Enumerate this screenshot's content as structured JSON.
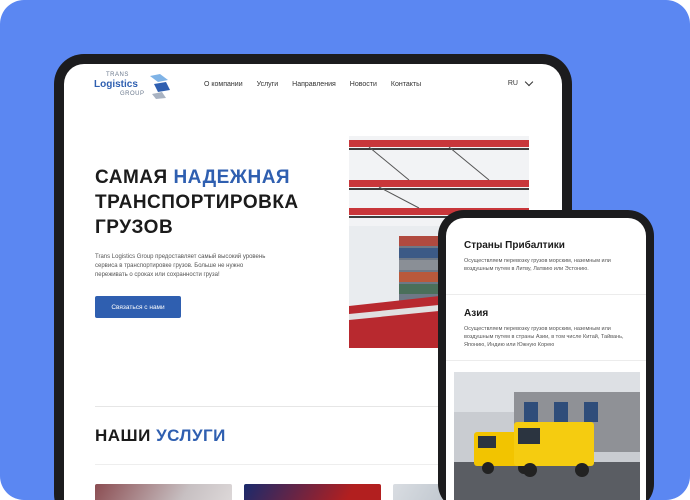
{
  "logo": {
    "line1": "TRANS",
    "line2": "LOGISTICS",
    "line3": "GROUP"
  },
  "nav": {
    "items": [
      "О компании",
      "Услуги",
      "Направления",
      "Новости",
      "Контакты"
    ]
  },
  "language": {
    "selected": "RU"
  },
  "hero": {
    "title_part1": "САМАЯ ",
    "title_accent": "НАДЕЖНАЯ",
    "title_part2": "ТРАНСПОРТИРОВКА ГРУЗОВ",
    "description": "Trans Logistics Group предоставляет самый высокий уровень сервиса в транспортировке грузов. Больше не нужно переживать о сроках или сохранности груза!",
    "cta_label": "Связаться с нами"
  },
  "services": {
    "title_part1": "НАШИ ",
    "title_accent": "УСЛУГИ"
  },
  "mobile": {
    "sections": [
      {
        "title": "Страны Прибалтики",
        "text": "Осуществляем перевозку грузов морским, наземным или воздушным путем в Литву, Латвию или Эстонию."
      },
      {
        "title": "Азия",
        "text": "Осуществляем перевозку грузов морским, наземным или воздушным путем в страны Азии, в том числе Китай, Тайвань, Японию, Индию или Южную Корею"
      }
    ]
  },
  "colors": {
    "accent": "#2f5fb0",
    "background": "#5b87f2",
    "device": "#1c1c1e"
  }
}
